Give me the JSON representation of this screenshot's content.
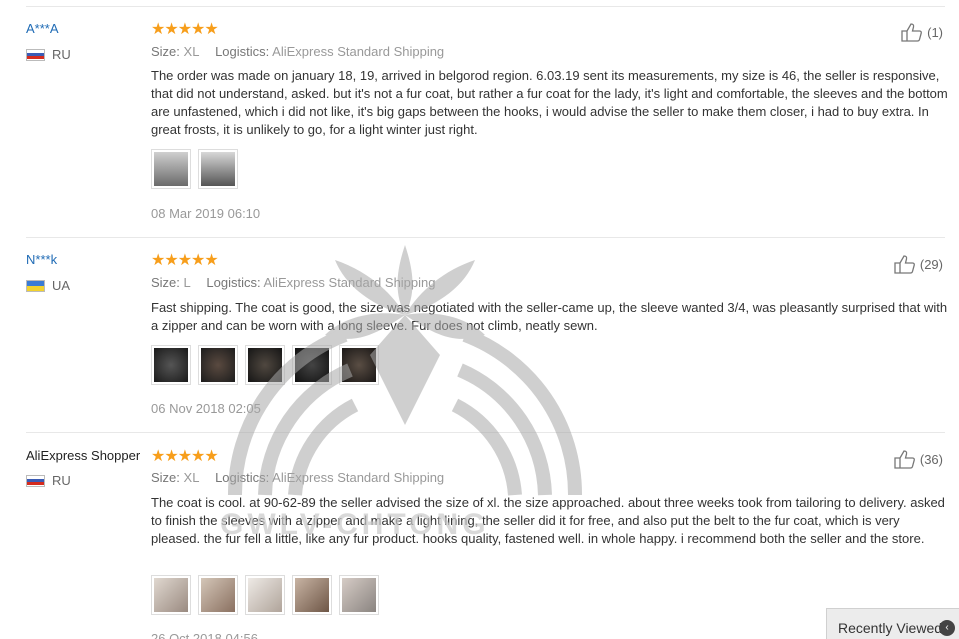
{
  "reviews": [
    {
      "user": "A***A",
      "country": "RU",
      "stars": "★★★★★",
      "size_label": "Size:",
      "size_value": "XL",
      "logistics_label": "Logistics:",
      "logistics_value": "AliExpress Standard Shipping",
      "text": "The order was made on january 18, 19, arrived in belgorod region. 6.03.19 sent its measurements, my size is 46, the seller is responsive, that did not understand, asked. but it's not a fur coat, but rather a fur coat for the lady, it's light and comfortable, the sleeves and the bottom are unfastened, which i did not like, it's big gaps between the hooks, i would advise the seller to make them closer, i had to buy extra. In great frosts, it is unlikely to go, for a light winter just right.",
      "date": "08 Mar 2019 06:10",
      "likes": "(1)",
      "photo_colors": [
        "#6b6b6b",
        "#8a8a8a"
      ]
    },
    {
      "user": "N***k",
      "country": "UA",
      "stars": "★★★★★",
      "size_label": "Size:",
      "size_value": "L",
      "logistics_label": "Logistics:",
      "logistics_value": "AliExpress Standard Shipping",
      "text": "Fast shipping. The coat is good, the size was negotiated with the seller-came up, the sleeve wanted 3/4, was pleasantly surprised that with a zipper and can be worn with a long sleeve. Fur does not climb, neatly sewn.",
      "date": "06 Nov 2018 02:05",
      "likes": "(29)",
      "photo_colors": [
        "#2a2a2a",
        "#3a3030",
        "#2e2a28",
        "#222222",
        "#302a26"
      ]
    },
    {
      "user": "AliExpress Shopper",
      "country": "RU",
      "stars": "★★★★★",
      "size_label": "Size:",
      "size_value": "XL",
      "logistics_label": "Logistics:",
      "logistics_value": "AliExpress Standard Shipping",
      "text": "The coat is cool. at 90-62-89 the seller advised the size of xl. the size approached. about three weeks took from tailoring to delivery. asked to finish the sleeves with a zipper and make a light lining, the seller did it for free, and also put the belt to the fur coat, which is very pleased. the fur fell a little, like any fur product. hooks quality, fastened well. in whole happy. i recommend both the seller and the store.",
      "date": "26 Oct 2018 04:56",
      "likes": "(36)",
      "photo_colors": [
        "#b5aaa2",
        "#a8968a",
        "#c9c0b8",
        "#9d8b7e",
        "#b0a8a4"
      ]
    }
  ],
  "watermark": "GWLV-CHTONG",
  "recent_viewed": "Recently Viewed",
  "colors": {
    "star": "#f79e1b",
    "user_link": "#1f6bb5",
    "meta": "#999999"
  }
}
